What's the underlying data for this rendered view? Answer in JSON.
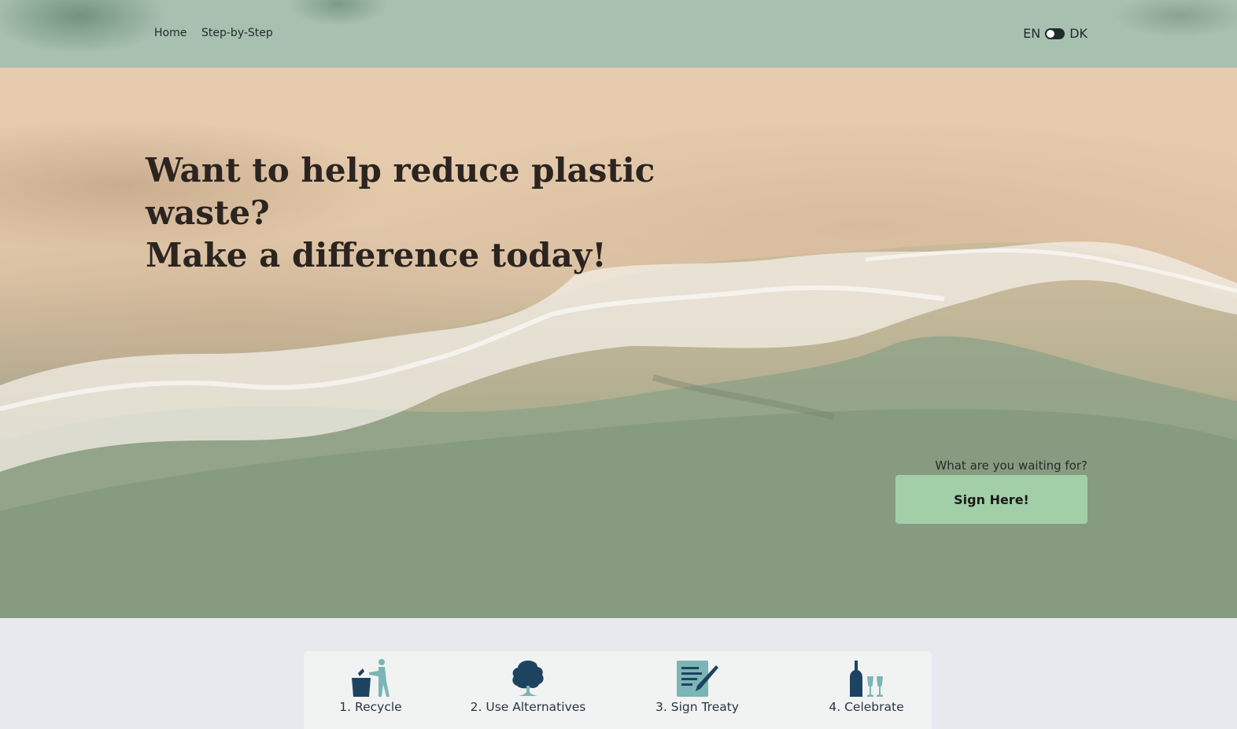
{
  "nav": {
    "links": [
      {
        "label": "Home"
      },
      {
        "label": "Step-by-Step"
      }
    ],
    "language": {
      "left": "EN",
      "right": "DK",
      "selected": "EN"
    }
  },
  "hero": {
    "headline_line1": "Want to help reduce plastic waste?",
    "headline_line2": "Make a difference today!",
    "cta_question": "What are you waiting for?",
    "cta_button": "Sign Here!"
  },
  "steps": [
    {
      "label": "1. Recycle",
      "icon": "recycle-bin-person-icon"
    },
    {
      "label": "2. Use Alternatives",
      "icon": "tree-icon"
    },
    {
      "label": "3. Sign Treaty",
      "icon": "document-pen-icon"
    },
    {
      "label": "4. Celebrate",
      "icon": "bottle-glasses-icon"
    }
  ],
  "colors": {
    "navbar": "#a8c0b0",
    "cta_button": "#a3cfa8",
    "icon_dark": "#1d4361",
    "icon_light": "#7cb5b5",
    "page_bg": "#e6eaee"
  }
}
